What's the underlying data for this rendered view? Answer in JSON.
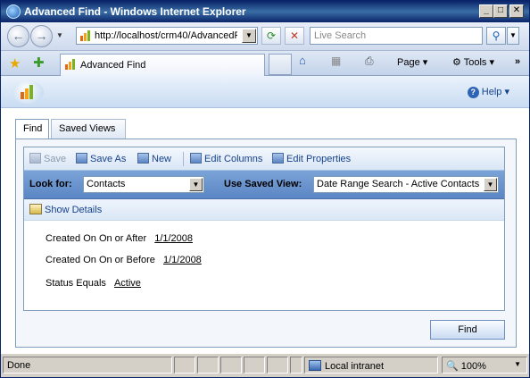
{
  "window": {
    "title": "Advanced Find - Windows Internet Explorer",
    "minimize": "_",
    "maximize": "□",
    "close": "✕"
  },
  "nav": {
    "back": "←",
    "forward": "→",
    "history_dropdown": "▼",
    "address": "http://localhost/crm40/AdvancedF",
    "address_dropdown": "▼",
    "refresh": "⟳",
    "stop": "✕",
    "search_placeholder": "Live Search",
    "search_go": "⚲",
    "search_dropdown": "▼"
  },
  "tabbar": {
    "favorites": "★",
    "add_favorites": "✚",
    "page_tab": "Advanced Find",
    "home": "⌂",
    "feeds": "▦",
    "print": "⎙",
    "page_menu": "Page ▾",
    "tools_menu": "⚙ Tools ▾",
    "more": "»"
  },
  "crm": {
    "help": "Help",
    "help_dropdown": "▾",
    "tabs": [
      "Find",
      "Saved Views"
    ],
    "toolbar": {
      "save": "Save",
      "save_as": "Save As",
      "new": "New",
      "edit_columns": "Edit Columns",
      "edit_properties": "Edit Properties"
    },
    "look_for_label": "Look for:",
    "look_for_value": "Contacts",
    "saved_view_label": "Use Saved View:",
    "saved_view_value": "Date Range Search - Active Contacts",
    "show_details": "Show Details",
    "criteria": [
      {
        "field": "Created On",
        "operator": "On or After",
        "value": "1/1/2008"
      },
      {
        "field": "Created On",
        "operator": "On or Before",
        "value": "1/1/2008"
      },
      {
        "field": "Status",
        "operator": "Equals",
        "value": "Active"
      }
    ],
    "find_button": "Find"
  },
  "status": {
    "text": "Done",
    "zone": "Local intranet",
    "zoom": "100%",
    "zoom_icon": "🔍"
  }
}
